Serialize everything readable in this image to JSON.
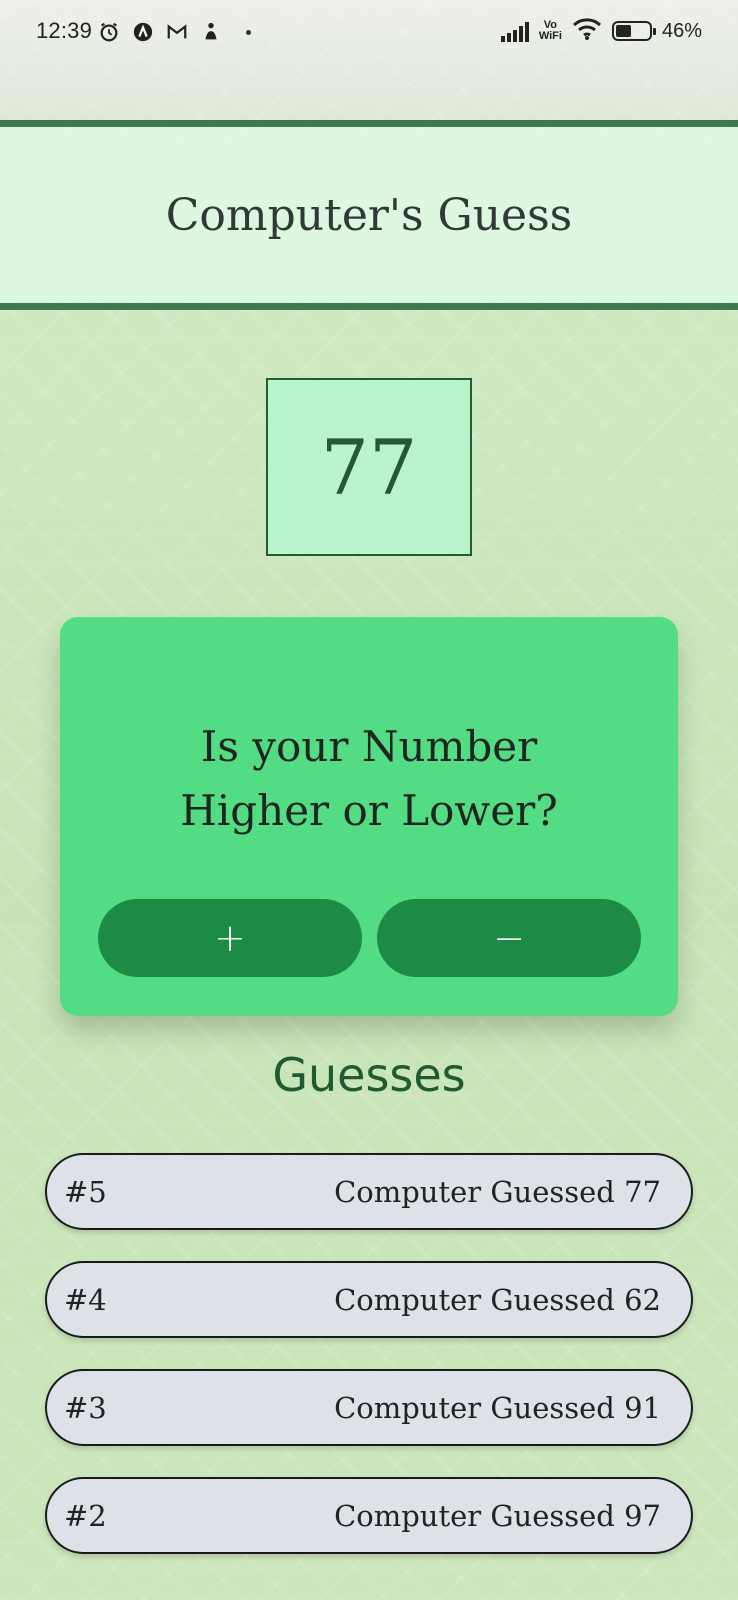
{
  "status_bar": {
    "time": "12:39",
    "left_icons": [
      "alarm-icon",
      "a-circle-icon",
      "gmail-icon",
      "figure-icon"
    ],
    "vowifi_top": "Vo",
    "vowifi_bottom": "WiFi",
    "battery_text": "46%",
    "battery_level": 0.46
  },
  "header": {
    "title": "Computer's Guess"
  },
  "current_guess": {
    "value": "77"
  },
  "card": {
    "question_line1": "Is your Number",
    "question_line2": "Higher or Lower?",
    "higher_label": "+",
    "lower_label": "−"
  },
  "guesses": {
    "title": "Guesses",
    "items": [
      {
        "index": "#5",
        "text": "Computer Guessed 77"
      },
      {
        "index": "#4",
        "text": "Computer Guessed 62"
      },
      {
        "index": "#3",
        "text": "Computer Guessed 91"
      },
      {
        "index": "#2",
        "text": "Computer Guessed 97"
      }
    ]
  },
  "colors": {
    "accent_dark_green": "#1b8b46",
    "card_green": "#53dc84",
    "header_border": "#3c7b4d",
    "number_box_bg": "#b9f4cf",
    "guess_item_bg": "#dde2e8"
  }
}
